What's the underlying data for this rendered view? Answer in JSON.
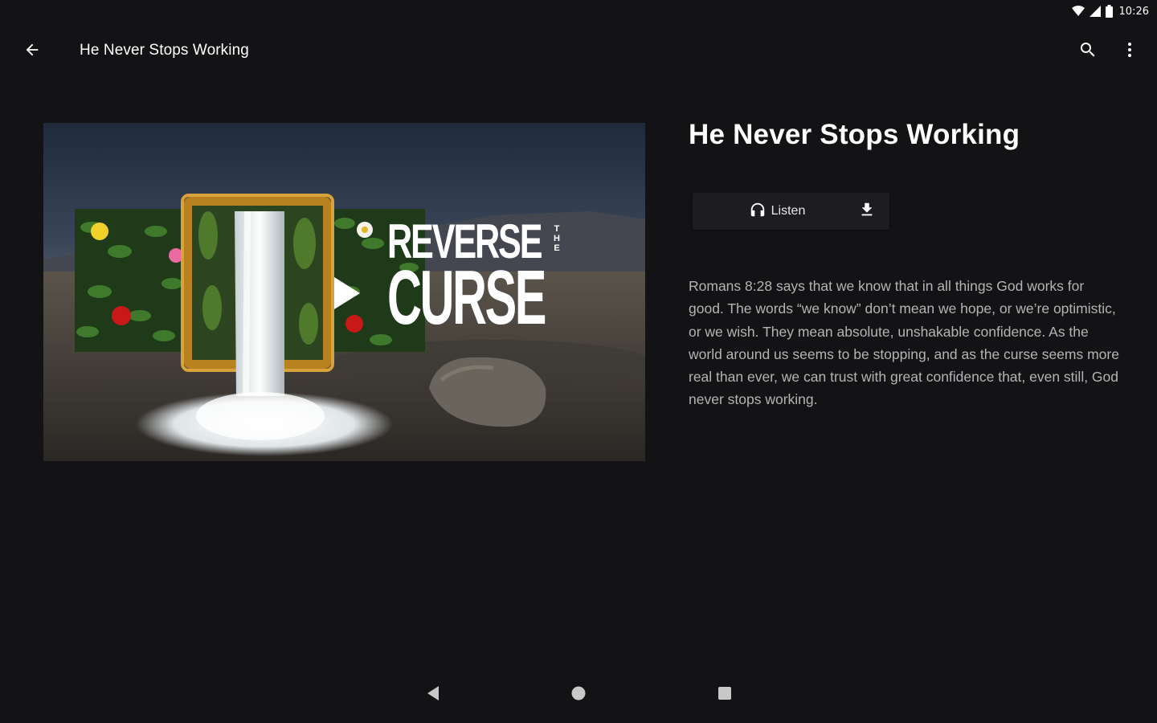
{
  "status_bar": {
    "time": "10:26",
    "icons": [
      "wifi-icon",
      "signal-icon",
      "battery-icon"
    ]
  },
  "app_bar": {
    "title": "He Never Stops Working",
    "icons": [
      "arrow-back-icon",
      "search-icon",
      "more-vert-icon"
    ]
  },
  "artwork": {
    "title_line1": "REVERSE",
    "title_small": "THE",
    "title_line2": "CURSE",
    "overlay_icon": "play-icon"
  },
  "episode": {
    "title": "He Never Stops Working",
    "listen_label": "Listen",
    "listen_icon": "headphones-icon",
    "download_icon": "download-icon",
    "description": "Romans 8:28 says that we know that in all things God works for good. The words “we know” don’t mean we hope, or we’re optimistic, or we wish. They mean absolute, unshakable confidence. As the world around us seems to be stopping, and as the curse seems more real than ever, we can trust with great confidence that, even still, God never stops working."
  },
  "nav_bar": {
    "icons": [
      "nav-back-icon",
      "nav-home-icon",
      "nav-recents-icon"
    ]
  },
  "colors": {
    "background": "#131316",
    "button_bg": "#1d1d21",
    "primary_text": "#ffffff",
    "secondary_text": "#b4b4b4"
  }
}
